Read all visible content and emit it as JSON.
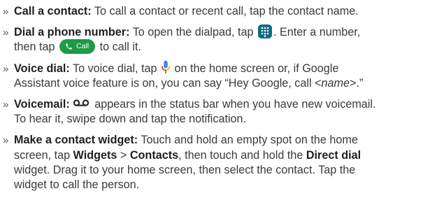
{
  "icons": {
    "bullet": "»",
    "dialpad": "dialpad-icon",
    "call": "phone-icon",
    "mic": "google-mic-icon",
    "voicemail": "voicemail-icon"
  },
  "colors": {
    "dialpad_bg": "#0f6b86",
    "call_button": "#1e9a46",
    "mic_blue": "#4285f4",
    "mic_red": "#ea4335",
    "mic_yellow": "#fbbc04",
    "mic_green": "#34a853"
  },
  "items": [
    {
      "title": "Call a contact:",
      "t1": " To call a contact or recent call, tap the contact name."
    },
    {
      "title": "Dial a phone number:",
      "t1": " To open the dialpad, tap ",
      "t2": ". Enter a number,",
      "t3": "then tap ",
      "call_label": "Call",
      "t4": " to call it."
    },
    {
      "title": "Voice dial:",
      "t1": " To voice dial, tap ",
      "t2": " on the home screen or, if Google",
      "t3": "Assistant voice feature is on, you can say “Hey Google, call <",
      "name_placeholder": "name",
      "t4": ">.”"
    },
    {
      "title": "Voicemail:",
      "t1": " appears in the status bar when you have new voicemail.",
      "t2": "To hear it, swipe down and tap the notification."
    },
    {
      "title": "Make a contact widget:",
      "t1": " Touch and hold an empty spot on the home",
      "t2": "screen, tap ",
      "widgets": "Widgets",
      "gt": " > ",
      "contacts": "Contacts",
      "t3": ", then touch and hold the ",
      "direct_dial": "Direct dial",
      "t4": "widget. Drag it to your home screen, then select the contact. Tap the",
      "t5": "widget to call the person."
    }
  ]
}
